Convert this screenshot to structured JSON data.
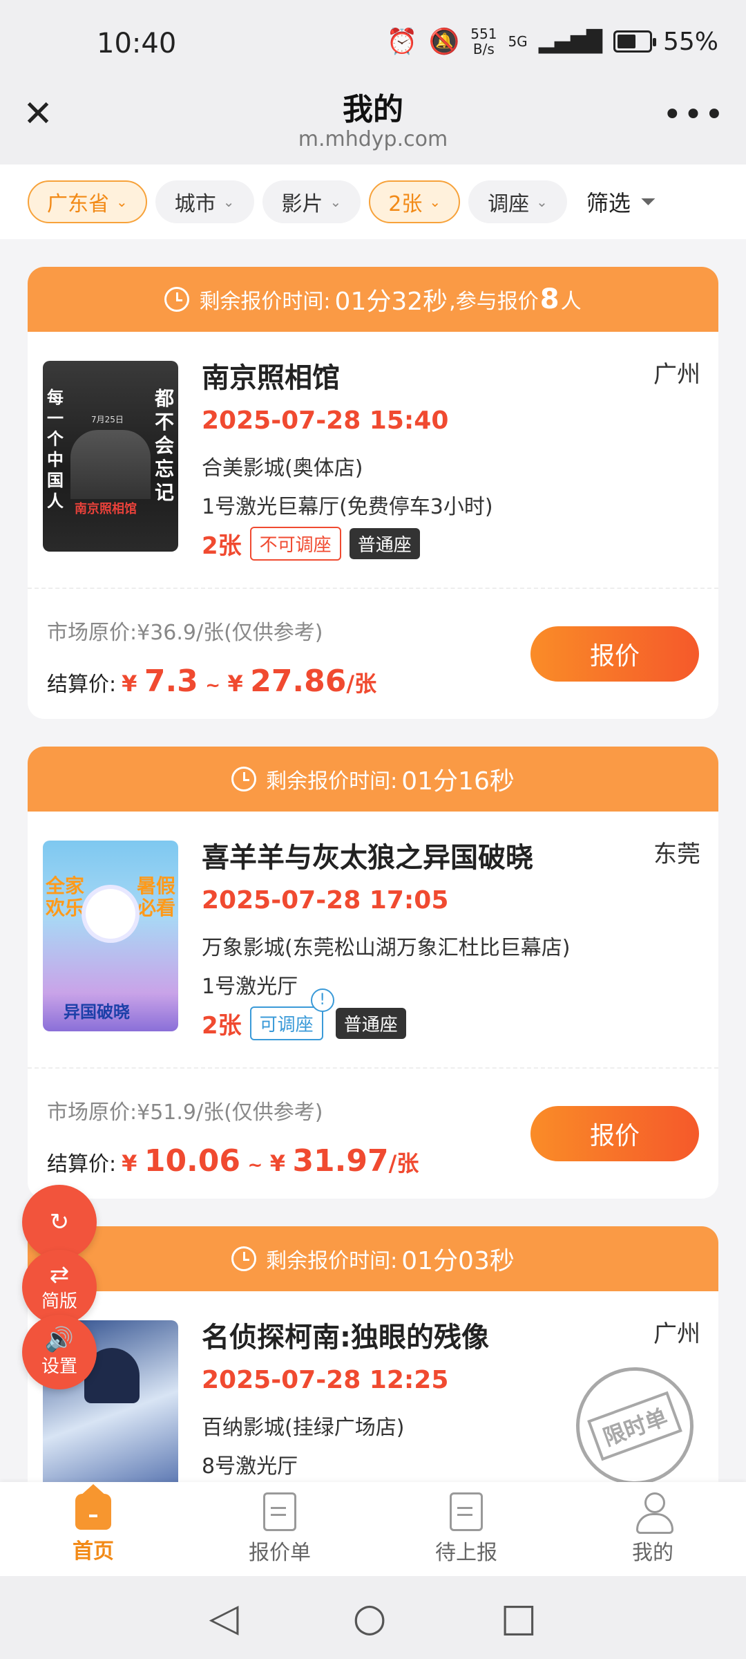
{
  "status_bar": {
    "time": "10:40",
    "net_speed_value": "551",
    "net_speed_unit": "B/s",
    "signal": "5G",
    "battery": "55%"
  },
  "header": {
    "title": "我的",
    "url": "m.mhdyp.com"
  },
  "filters": [
    {
      "label": "广东省",
      "active": true
    },
    {
      "label": "城市",
      "active": false
    },
    {
      "label": "影片",
      "active": false
    },
    {
      "label": "2张",
      "active": true
    },
    {
      "label": "调座",
      "active": false
    }
  ],
  "filter_screen": "筛选",
  "cards": [
    {
      "countdown_label": "剩余报价时间:",
      "countdown": "01分32秒",
      "participants_prefix": ",参与报价",
      "participants": "8",
      "participants_suffix": "人",
      "title": "南京照相馆",
      "city": "广州",
      "datetime": "2025-07-28 15:40",
      "cinema": "合美影城(奥体店)",
      "hall": "1号激光巨幕厅(免费停车3小时)",
      "qty": "2张",
      "seat_adjust": "不可调座",
      "seat_type": "普通座",
      "market_price": "市场原价:¥36.9/张(仅供参考)",
      "settle_label": "结算价:",
      "price_low": "7.3",
      "price_high": "27.86",
      "price_unit": "/张",
      "quote_button": "报价"
    },
    {
      "countdown_label": "剩余报价时间:",
      "countdown": "01分16秒",
      "title": "喜羊羊与灰太狼之异国破晓",
      "city": "东莞",
      "datetime": "2025-07-28 17:05",
      "cinema": "万象影城(东莞松山湖万象汇杜比巨幕店)",
      "hall": "1号激光厅",
      "qty": "2张",
      "seat_adjust": "可调座",
      "seat_type": "普通座",
      "market_price": "市场原价:¥51.9/张(仅供参考)",
      "settle_label": "结算价:",
      "price_low": "10.06",
      "price_high": "31.97",
      "price_unit": "/张",
      "quote_button": "报价"
    },
    {
      "countdown_label": "剩余报价时间:",
      "countdown": "01分03秒",
      "title": "名侦探柯南:独眼的残像",
      "city": "广州",
      "datetime": "2025-07-28 12:25",
      "cinema": "百纳影城(挂绿广场店)",
      "hall": "8号激光厅",
      "stamp": "限时单"
    }
  ],
  "posters": {
    "p1_text_left": "每一个中国人",
    "p1_text_right": "都不会忘记",
    "p1_date": "7月25日",
    "p1_title": "南京照相馆",
    "p2_left": "全家欢乐",
    "p2_right": "暑假必看",
    "p2_title": "异国破晓"
  },
  "currency": "¥",
  "range_sep": "~",
  "fabs": {
    "simple": "简版",
    "settings": "设置"
  },
  "tabs": [
    {
      "label": "首页",
      "active": true
    },
    {
      "label": "报价单",
      "active": false
    },
    {
      "label": "待上报",
      "active": false
    },
    {
      "label": "我的",
      "active": false
    }
  ],
  "colors": {
    "accent": "#fa9a45",
    "price": "#f04a30",
    "chip_active_bg": "#fff1dc"
  }
}
